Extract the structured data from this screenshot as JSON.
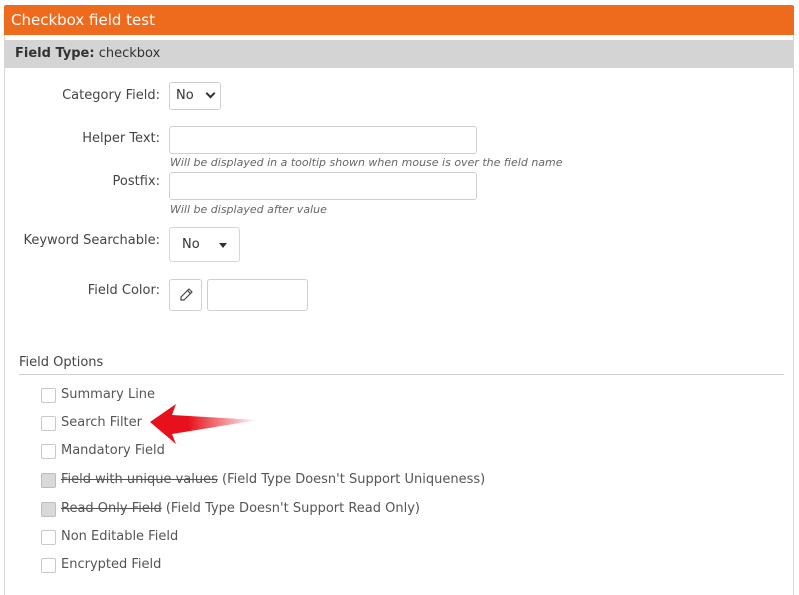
{
  "window": {
    "title": "Checkbox field test"
  },
  "field_type": {
    "label": "Field Type:",
    "value": "checkbox"
  },
  "form": {
    "category_field": {
      "label": "Category Field:",
      "value": "No"
    },
    "helper_text": {
      "label": "Helper Text:",
      "value": "",
      "hint": "Will be displayed in a tooltip shown when mouse is over the field name"
    },
    "postfix": {
      "label": "Postfix:",
      "value": "",
      "hint": "Will be displayed after value"
    },
    "keyword_searchable": {
      "label": "Keyword Searchable:",
      "value": "No"
    },
    "field_color": {
      "label": "Field Color:",
      "value": ""
    }
  },
  "field_options": {
    "title": "Field Options",
    "items": [
      {
        "label": "Summary Line",
        "note": "",
        "checked": false,
        "disabled": false
      },
      {
        "label": "Search Filter",
        "note": "",
        "checked": false,
        "disabled": false
      },
      {
        "label": "Mandatory Field",
        "note": "",
        "checked": false,
        "disabled": false
      },
      {
        "label": "Field with unique values",
        "note": "(Field Type Doesn't Support Uniqueness)",
        "checked": false,
        "disabled": true
      },
      {
        "label": "Read Only Field",
        "note": "(Field Type Doesn't Support Read Only)",
        "checked": false,
        "disabled": true
      },
      {
        "label": "Non Editable Field",
        "note": "",
        "checked": false,
        "disabled": false
      },
      {
        "label": "Encrypted Field",
        "note": "",
        "checked": false,
        "disabled": false
      }
    ]
  },
  "colors": {
    "header": "#ee6a1d",
    "annotation_arrow": "#e8101a"
  },
  "icons": {
    "picker": "eyedropper-icon",
    "annotation": "red-arrow-icon"
  }
}
